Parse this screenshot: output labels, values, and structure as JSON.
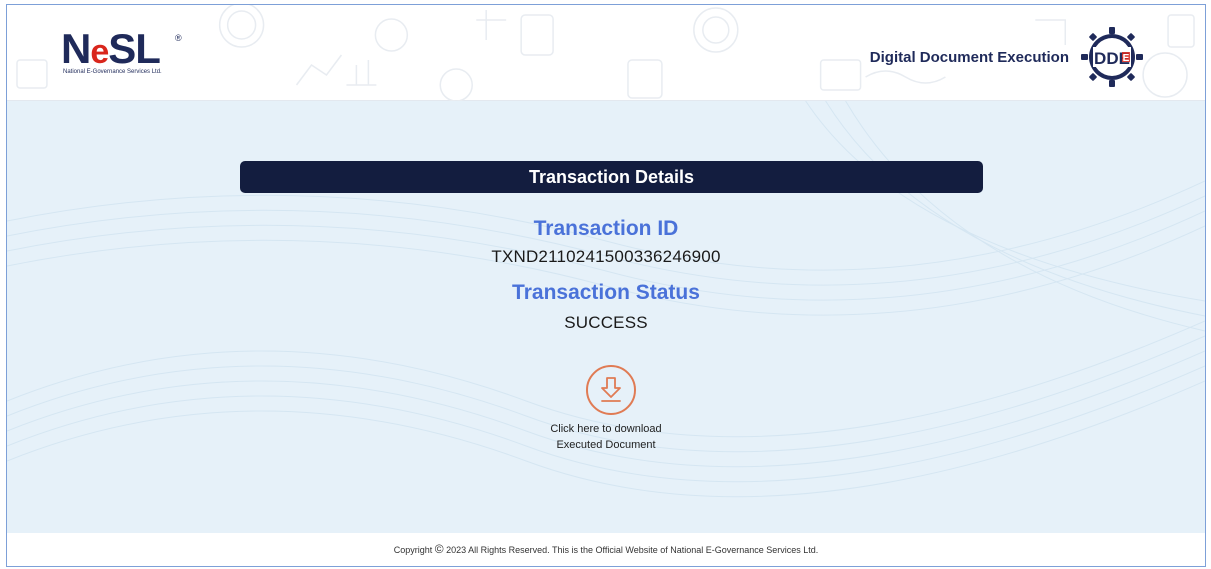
{
  "header": {
    "logo_word": "NeSL",
    "logo_subtitle": "National E-Governance Services Ltd.",
    "title": "Digital Document Execution",
    "dde_logo_text": "DDE"
  },
  "details": {
    "heading": "Transaction Details",
    "id_label": "Transaction ID",
    "id_value": "TXND2110241500336246900",
    "status_label": "Transaction Status",
    "status_value": "SUCCESS",
    "download_line1": "Click here to download",
    "download_line2": "Executed Document",
    "download_icon": "download-arrow-icon"
  },
  "footer": {
    "copyright_symbol": "©",
    "text_before": "Copyright",
    "text_after": "2023 All Rights Reserved. This is the Official Website of National E-Governance Services Ltd."
  },
  "colors": {
    "navy": "#131d3f",
    "accent_blue": "#4a72d9",
    "download_orange": "#e07b54",
    "background": "#e6f1f9"
  }
}
